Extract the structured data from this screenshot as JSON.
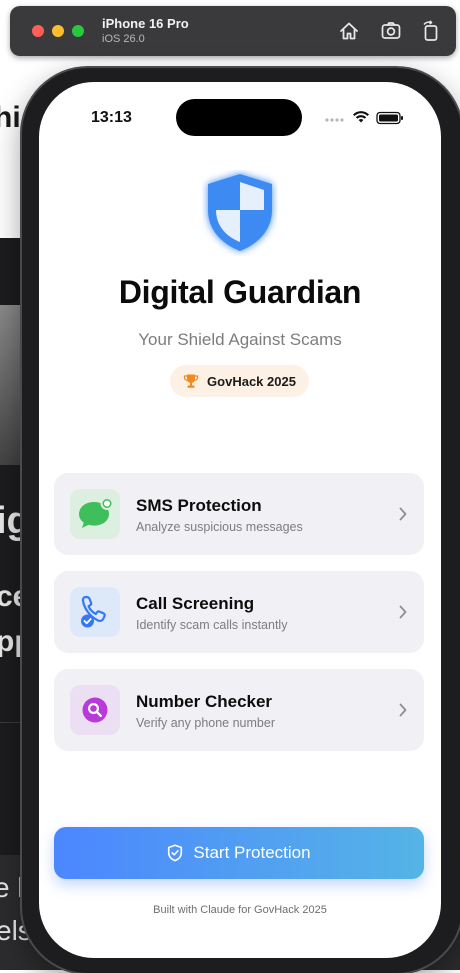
{
  "simulator": {
    "device": "iPhone 16 Pro",
    "os": "iOS 26.0",
    "icons": [
      "home-icon",
      "screenshot-icon",
      "rotate-icon"
    ]
  },
  "background_app": {
    "fragments": [
      "hi",
      "ig",
      "ce",
      "pp",
      "e l",
      "els"
    ]
  },
  "status_bar": {
    "time": "13:13",
    "icons": [
      "signal-icon",
      "wifi-icon",
      "battery-icon"
    ]
  },
  "app": {
    "title": "Digital Guardian",
    "subtitle": "Your Shield Against Scams",
    "badge": {
      "icon": "trophy-icon",
      "label": "GovHack 2025"
    },
    "features": [
      {
        "icon": "message-bubble-icon",
        "title": "SMS Protection",
        "description": "Analyze suspicious messages",
        "icon_bg": "#dcefe0",
        "icon_color": "#3fbf5b"
      },
      {
        "icon": "phone-check-icon",
        "title": "Call Screening",
        "description": "Identify scam calls instantly",
        "icon_bg": "#dde8f8",
        "icon_color": "#3478f6"
      },
      {
        "icon": "magnifier-icon",
        "title": "Number Checker",
        "description": "Verify any phone number",
        "icon_bg": "#ecdff3",
        "icon_color": "#b73ad9"
      }
    ],
    "cta": {
      "icon": "shield-check-icon",
      "label": "Start Protection"
    },
    "footer": "Built with Claude for GovHack 2025"
  },
  "colors": {
    "accent_start": "#4c86ff",
    "accent_end": "#55b4e6",
    "shield": "#3d8bf2",
    "badge_bg": "#fdf0e4",
    "card_bg": "#f1f1f5"
  }
}
